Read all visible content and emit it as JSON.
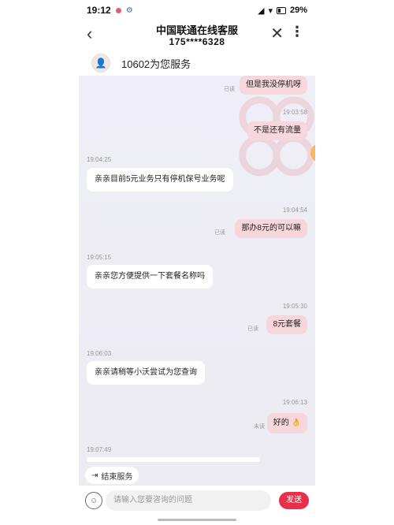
{
  "status_bar": {
    "time": "19:12",
    "battery": "29%"
  },
  "header": {
    "title": "中国联通在线客服",
    "subtitle": "175****6328",
    "back_glyph": "‹",
    "close_glyph": "✕",
    "more_glyph": "⋮"
  },
  "agent": {
    "name": "10602为您服务"
  },
  "messages": [
    {
      "side": "right",
      "time": "",
      "text": "但是我没停机呀",
      "status": "已读"
    },
    {
      "side": "right",
      "time": "19:03:58",
      "text": "不是还有流量",
      "status": ""
    },
    {
      "side": "left",
      "time": "19:04:25",
      "text": "亲亲目前5元业务只有停机保号业务呢"
    },
    {
      "side": "right",
      "time": "19:04:54",
      "text": "那办8元的可以嘛",
      "status": "已读"
    },
    {
      "side": "left",
      "time": "19:05:15",
      "text": "亲亲您方便提供一下套餐名称吗"
    },
    {
      "side": "right",
      "time": "19:05:30",
      "text": "8元套餐",
      "status": "已读"
    },
    {
      "side": "left",
      "time": "19:06:03",
      "text": "亲亲请稍等小沃尝试为您查询"
    },
    {
      "side": "right",
      "time": "19:06:13",
      "text": "好的",
      "status": "未读"
    },
    {
      "side": "left",
      "time": "19:07:49",
      "text": ""
    }
  ],
  "footer": {
    "end_service": "结束服务",
    "input_placeholder": "请输入您要咨询的问题",
    "send_label": "发送"
  },
  "colors": {
    "accent": "#e8304a",
    "bubble_right": "#f7d7db",
    "chat_bg": "#eeedf4"
  },
  "icons": [
    "back-icon",
    "close-icon",
    "more-icon",
    "emoji-icon",
    "end-service-icon",
    "avatar"
  ]
}
